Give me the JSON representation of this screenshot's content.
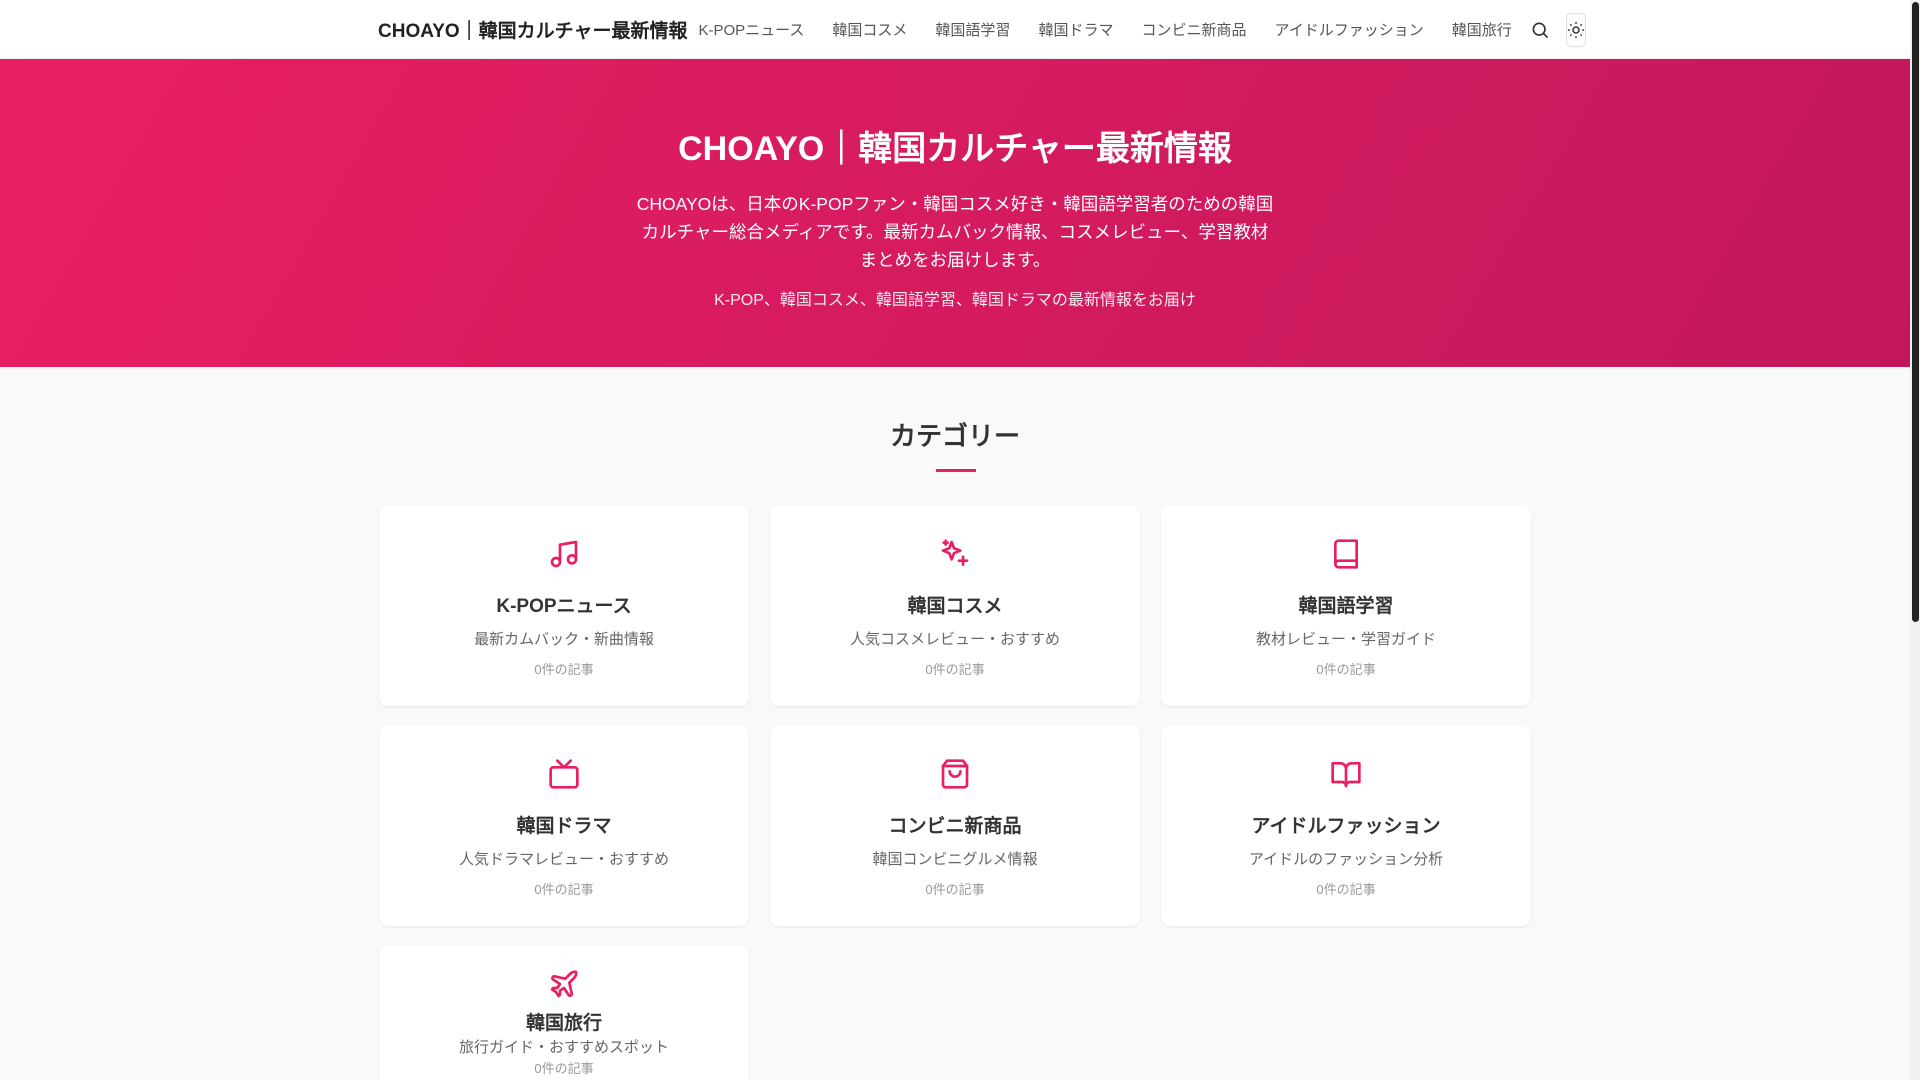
{
  "header": {
    "logo": "CHOAYO｜韓国カルチャー最新情報",
    "nav": [
      "K-POPニュース",
      "韓国コスメ",
      "韓国語学習",
      "韓国ドラマ",
      "コンビニ新商品",
      "アイドルファッション",
      "韓国旅行"
    ]
  },
  "hero": {
    "title": "CHOAYO｜韓国カルチャー最新情報",
    "description": "CHOAYOは、日本のK-POPファン・韓国コスメ好き・韓国語学習者のための韓国カルチャー総合メディアです。最新カムバック情報、コスメレビュー、学習教材まとめをお届けします。",
    "tagline": "K-POP、韓国コスメ、韓国語学習、韓国ドラマの最新情報をお届け"
  },
  "categories": {
    "title": "カテゴリー",
    "accent": "#e91e63",
    "items": [
      {
        "icon": "music-icon",
        "title": "K-POPニュース",
        "desc": "最新カムバック・新曲情報",
        "count": "0件の記事"
      },
      {
        "icon": "sparkles-icon",
        "title": "韓国コスメ",
        "desc": "人気コスメレビュー・おすすめ",
        "count": "0件の記事"
      },
      {
        "icon": "book-icon",
        "title": "韓国語学習",
        "desc": "教材レビュー・学習ガイド",
        "count": "0件の記事"
      },
      {
        "icon": "tv-icon",
        "title": "韓国ドラマ",
        "desc": "人気ドラマレビュー・おすすめ",
        "count": "0件の記事"
      },
      {
        "icon": "shopping-bag-icon",
        "title": "コンビニ新商品",
        "desc": "韓国コンビニグルメ情報",
        "count": "0件の記事"
      },
      {
        "icon": "book-open-icon",
        "title": "アイドルファッション",
        "desc": "アイドルのファッション分析",
        "count": "0件の記事"
      },
      {
        "icon": "plane-icon",
        "title": "韓国旅行",
        "desc": "旅行ガイド・おすすめスポット",
        "count": "0件の記事"
      }
    ]
  }
}
